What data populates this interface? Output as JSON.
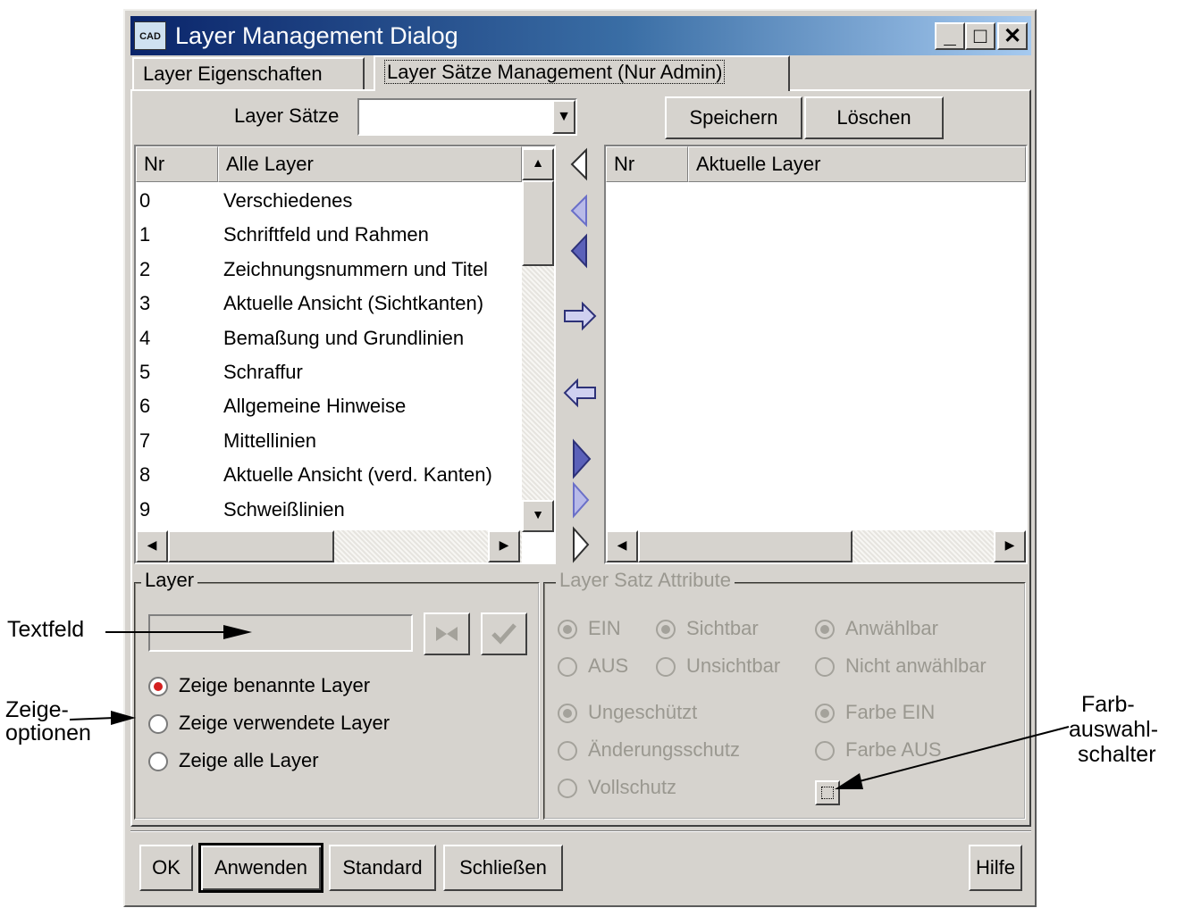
{
  "window": {
    "title": "Layer Management Dialog",
    "icon_label": "CAD",
    "minimize_label": "_",
    "maximize_label": "□",
    "close_label": "✕"
  },
  "tabs": [
    {
      "label": "Layer Eigenschaften",
      "active": false
    },
    {
      "label": "Layer Sätze Management (Nur Admin)",
      "active": true
    }
  ],
  "layer_sets": {
    "label": "Layer Sätze",
    "value": "",
    "save_label": "Speichern",
    "delete_label": "Löschen"
  },
  "all_layers": {
    "columns": [
      "Nr",
      "Alle Layer"
    ],
    "rows": [
      {
        "nr": "0",
        "name": "Verschiedenes"
      },
      {
        "nr": "1",
        "name": "Schriftfeld und Rahmen"
      },
      {
        "nr": "2",
        "name": "Zeichnungsnummern und Titel"
      },
      {
        "nr": "3",
        "name": "Aktuelle Ansicht (Sichtkanten)"
      },
      {
        "nr": "4",
        "name": "Bemaßung und Grundlinien"
      },
      {
        "nr": "5",
        "name": "Schraffur"
      },
      {
        "nr": "6",
        "name": "Allgemeine Hinweise"
      },
      {
        "nr": "7",
        "name": "Mittellinien"
      },
      {
        "nr": "8",
        "name": "Aktuelle Ansicht (verd. Kanten)"
      },
      {
        "nr": "9",
        "name": "Schweißlinien"
      }
    ]
  },
  "current_layers": {
    "columns": [
      "Nr",
      "Aktuelle Layer"
    ],
    "rows": []
  },
  "transfer_icons": [
    "triangle-left-outline-icon",
    "triangle-left-light-icon",
    "triangle-left-dark-icon",
    "arrow-right-icon",
    "arrow-left-icon",
    "triangle-right-dark-icon",
    "triangle-right-light-icon",
    "triangle-right-outline-icon"
  ],
  "layer_group": {
    "title": "Layer",
    "textfield_value": "",
    "options": [
      {
        "label": "Zeige benannte Layer",
        "selected": true
      },
      {
        "label": "Zeige verwendete Layer",
        "selected": false
      },
      {
        "label": "Zeige alle Layer",
        "selected": false
      }
    ]
  },
  "attributes_group": {
    "title": "Layer Satz Attribute",
    "on": "EIN",
    "off": "AUS",
    "visible": "Sichtbar",
    "invisible": "Unsichtbar",
    "selectable": "Anwählbar",
    "not_selectable": "Nicht anwählbar",
    "unprotected": "Ungeschützt",
    "change_protection": "Änderungsschutz",
    "full_protection": "Vollschutz",
    "color_on": "Farbe EIN",
    "color_off": "Farbe AUS"
  },
  "footer": {
    "ok": "OK",
    "apply": "Anwenden",
    "default": "Standard",
    "close": "Schließen",
    "help": "Hilfe"
  },
  "callouts": {
    "textfeld": "Textfeld",
    "zeige_1": "Zeige-",
    "zeige_2": "optionen",
    "farb_1": "Farb-",
    "farb_2": "auswahl-",
    "farb_3": "schalter"
  },
  "colors": {
    "title_start": "#0a246a",
    "title_end": "#a6caf0",
    "radio_selected": "#d42020",
    "arrow_blue": "#6a6fc8"
  }
}
